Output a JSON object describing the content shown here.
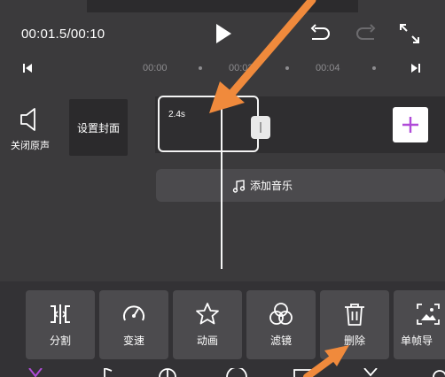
{
  "playback": {
    "time": "00:01.5/00:10"
  },
  "ruler": {
    "ticks": [
      "00:00",
      "00:02",
      "00:04"
    ]
  },
  "tracks": {
    "mute_label": "关闭原声",
    "cover_label": "设置封面",
    "clip_duration": "2.4s",
    "add_music_label": "添加音乐"
  },
  "toolbar": {
    "items": [
      {
        "label": "分割",
        "icon": "split-icon"
      },
      {
        "label": "变速",
        "icon": "speed-gauge-icon"
      },
      {
        "label": "动画",
        "icon": "animation-star-icon"
      },
      {
        "label": "滤镜",
        "icon": "filter-circles-icon"
      },
      {
        "label": "删除",
        "icon": "trash-icon"
      },
      {
        "label": "单帧导",
        "icon": "image-export-icon"
      }
    ]
  },
  "colors": {
    "background": "#3b3a3c",
    "panel": "#333235",
    "tool_bg": "#4c4b4e",
    "annotation": "#f08a3c",
    "accent": "#b04bd8"
  }
}
